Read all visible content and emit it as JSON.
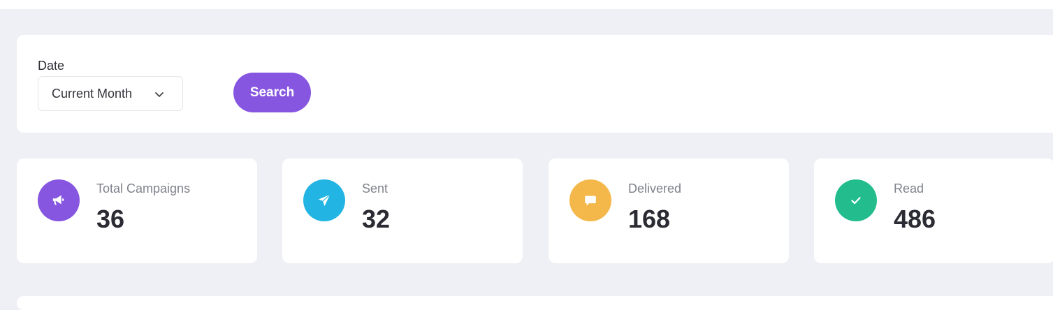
{
  "filter": {
    "date_label": "Date",
    "date_value": "Current Month",
    "search_label": "Search"
  },
  "stats": [
    {
      "label": "Total Campaigns",
      "value": "36",
      "icon": "megaphone-icon",
      "color": "#8656e0"
    },
    {
      "label": "Sent",
      "value": "32",
      "icon": "paper-plane-icon",
      "color": "#22b5e3"
    },
    {
      "label": "Delivered",
      "value": "168",
      "icon": "chat-bubble-icon",
      "color": "#f4b74a"
    },
    {
      "label": "Read",
      "value": "486",
      "icon": "check-icon",
      "color": "#23bd8d"
    }
  ]
}
